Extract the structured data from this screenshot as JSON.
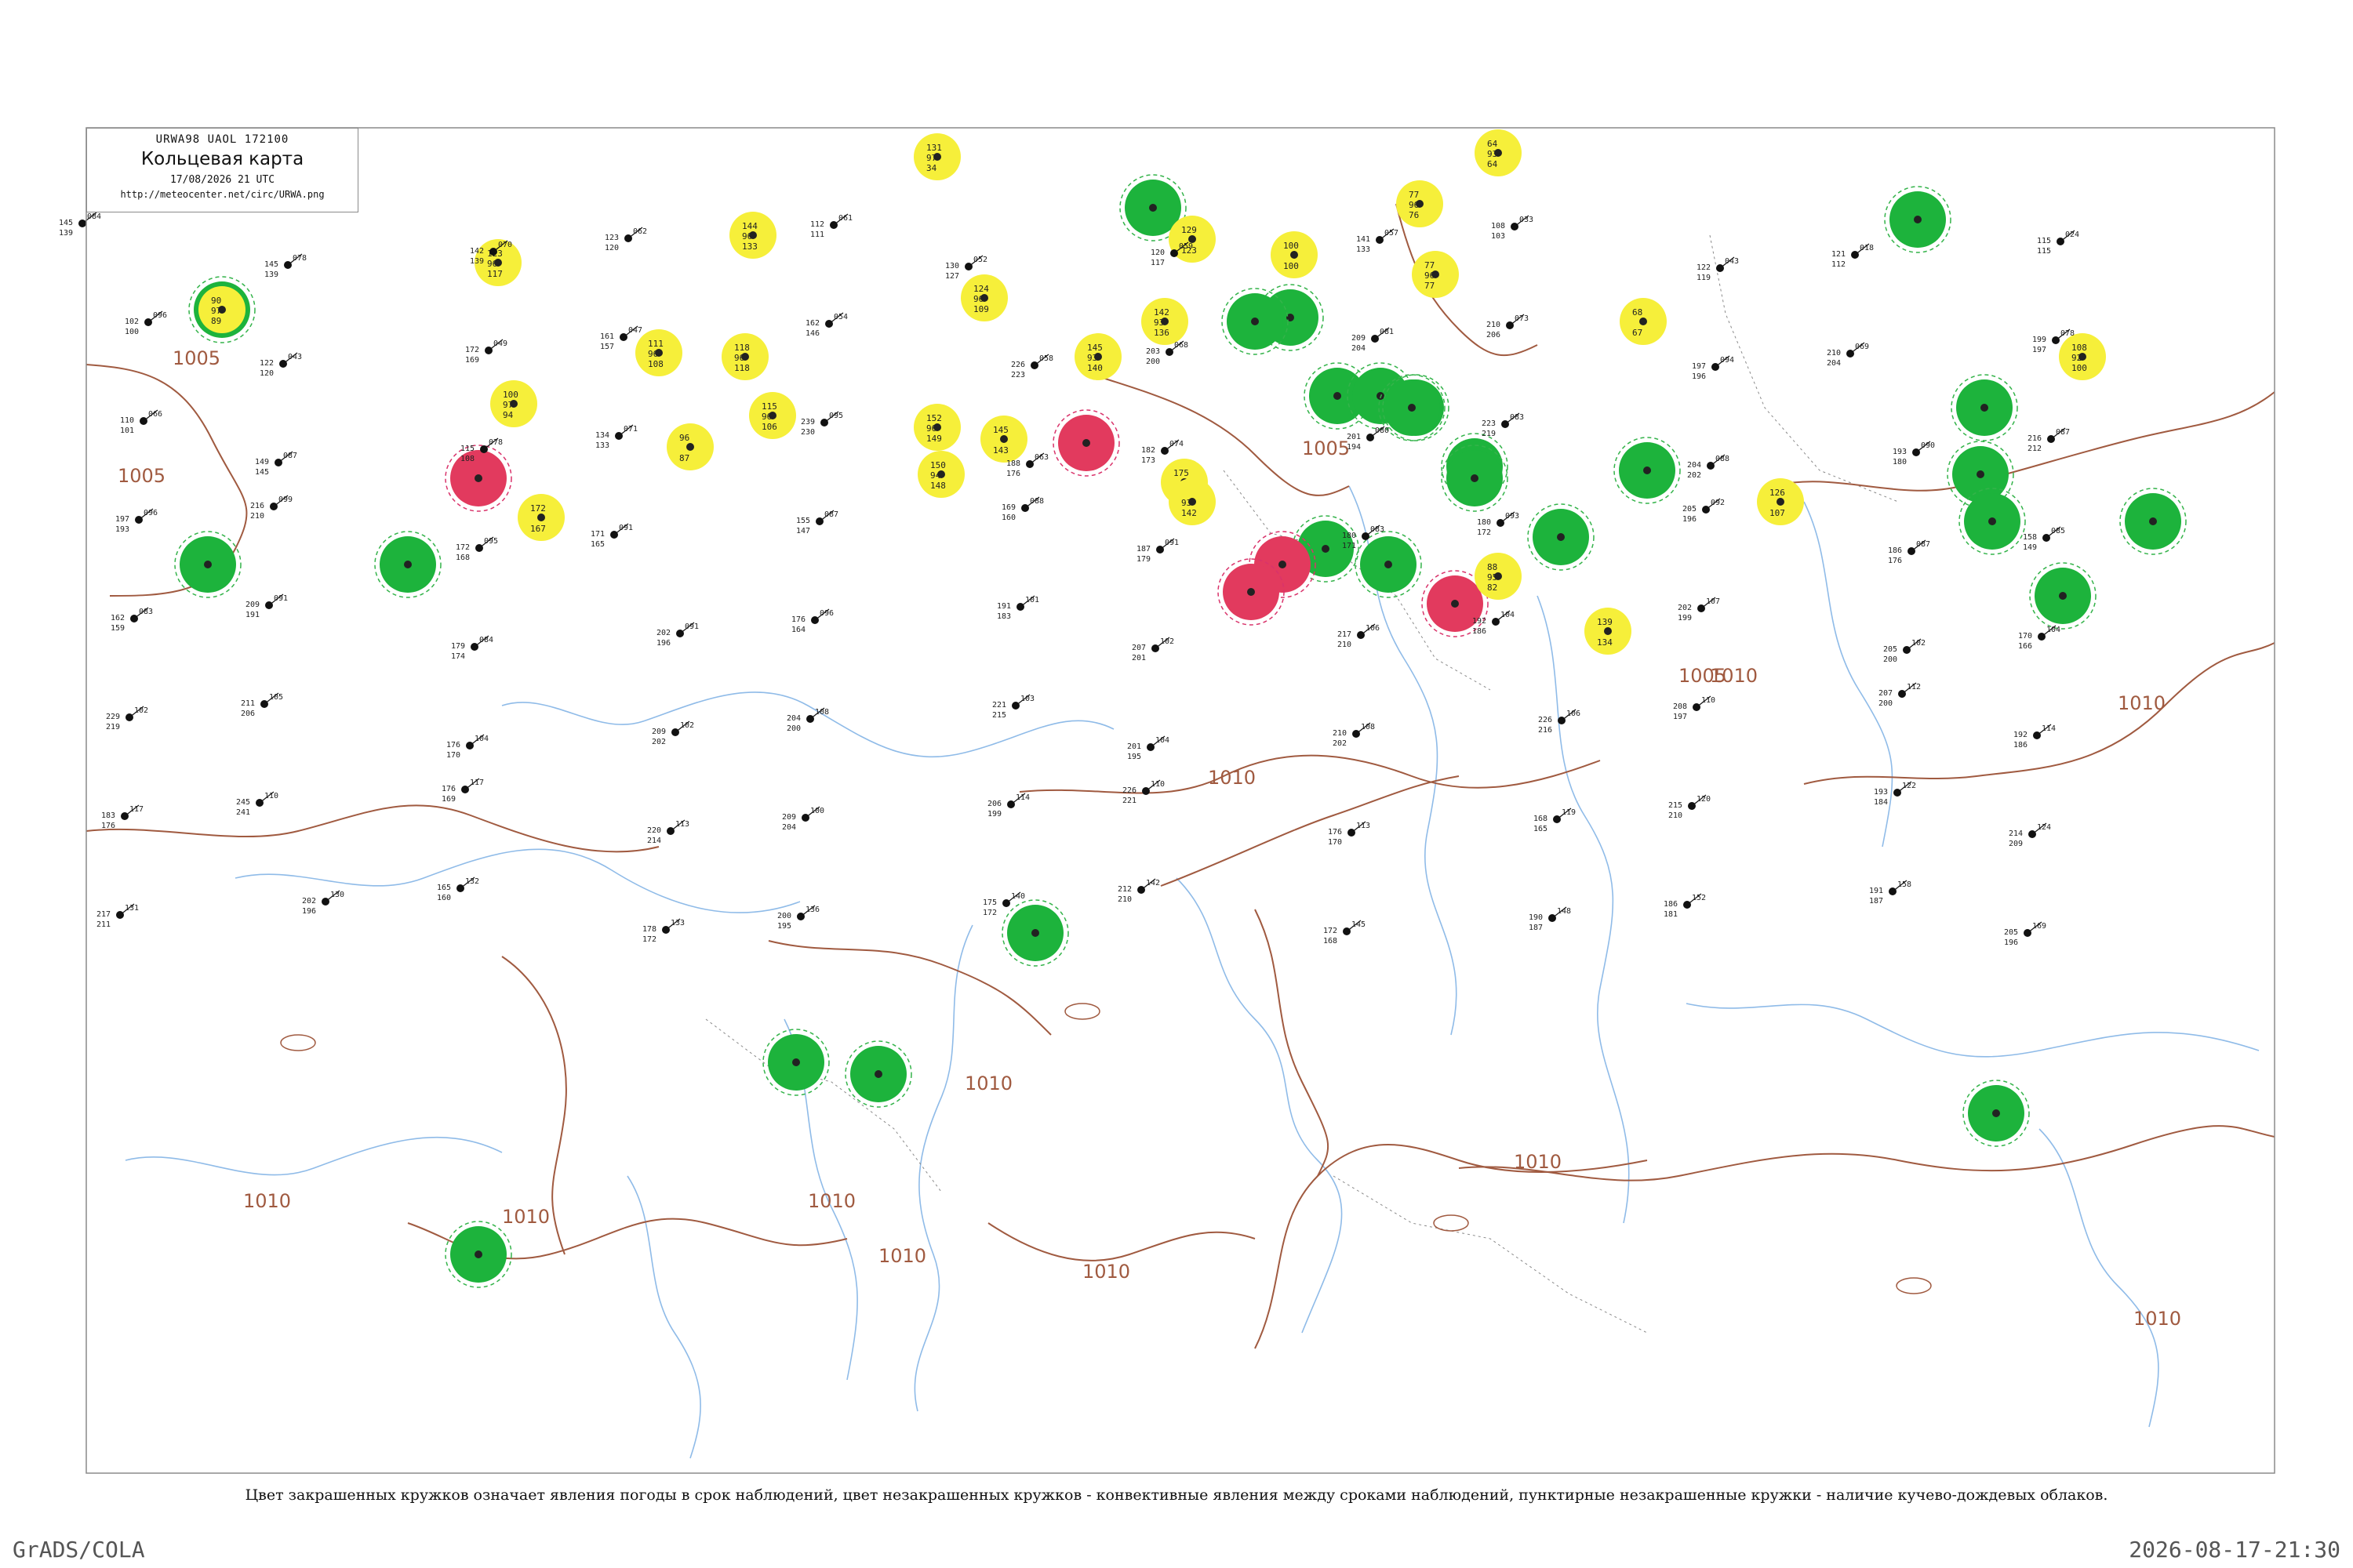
{
  "map": {
    "product_code": "URWA98  UAOL  172100",
    "title": "Кольцевая карта",
    "valid_time": "17/08/2026 21 UTC",
    "source_url": "http://meteocenter.net/circ/URWA.png",
    "caption": "Цвет закрашенных кружков означает явления погоды в срок наблюдений, цвет незакрашенных кружков - конвективные явления между сроками наблюдений, пунктирные незакрашенные кружки - наличие кучево-дождевых облаков.",
    "isobar_labels": [
      "1005",
      "1005",
      "1005",
      "1010",
      "1010",
      "1010",
      "1010",
      "1010",
      "1010",
      "1010",
      "1010",
      "1010",
      "1010",
      "1010",
      "1005"
    ],
    "colors": {
      "filled_green": "#1db33c",
      "filled_yellow": "#f6ef3a",
      "filled_red": "#e23a5e",
      "ring_green": "#34b34a",
      "ring_red": "#d9336b",
      "isobar": "#a05a40",
      "river": "#8fbbe8",
      "border": "#8a8a8a"
    },
    "highlighted_stations": [
      {
        "color": "green",
        "lines": [
          "",
          "",
          ""
        ]
      },
      {
        "color": "green",
        "lines": [
          "",
          "",
          ""
        ]
      },
      {
        "color": "green",
        "lines": [
          "",
          "",
          ""
        ]
      },
      {
        "color": "green",
        "lines": [
          "",
          "",
          ""
        ]
      },
      {
        "color": "green",
        "lines": [
          "",
          "",
          ""
        ]
      },
      {
        "color": "green",
        "lines": [
          "",
          "",
          ""
        ]
      },
      {
        "color": "green",
        "lines": [
          "",
          "",
          ""
        ]
      },
      {
        "color": "green",
        "lines": [
          "",
          "",
          ""
        ]
      },
      {
        "color": "green",
        "lines": [
          "",
          "",
          ""
        ]
      },
      {
        "color": "green",
        "lines": [
          "",
          "",
          ""
        ]
      },
      {
        "color": "green",
        "lines": [
          "",
          "",
          ""
        ]
      },
      {
        "color": "green",
        "lines": [
          "",
          "",
          ""
        ]
      },
      {
        "color": "green",
        "lines": [
          "",
          "",
          ""
        ]
      },
      {
        "color": "green",
        "lines": [
          "",
          "",
          ""
        ]
      },
      {
        "color": "green",
        "lines": [
          "",
          "",
          ""
        ]
      },
      {
        "color": "green",
        "lines": [
          "",
          "",
          ""
        ]
      },
      {
        "color": "green",
        "lines": [
          "",
          "",
          ""
        ]
      },
      {
        "color": "green",
        "lines": [
          "",
          "",
          ""
        ]
      },
      {
        "color": "green",
        "lines": [
          "",
          "",
          ""
        ]
      },
      {
        "color": "green",
        "lines": [
          "",
          "",
          ""
        ]
      },
      {
        "color": "green",
        "lines": [
          "",
          "",
          ""
        ]
      },
      {
        "color": "green",
        "lines": [
          "",
          "",
          ""
        ]
      },
      {
        "color": "green",
        "lines": [
          "",
          "",
          ""
        ]
      },
      {
        "color": "green",
        "lines": [
          "",
          "",
          ""
        ]
      },
      {
        "color": "green",
        "lines": [
          "",
          "",
          ""
        ]
      },
      {
        "color": "green",
        "lines": [
          "",
          "",
          ""
        ]
      },
      {
        "color": "green",
        "lines": [
          "",
          "",
          ""
        ]
      },
      {
        "color": "red",
        "lines": [
          "",
          "",
          ""
        ]
      },
      {
        "color": "red",
        "lines": [
          "",
          "",
          ""
        ]
      },
      {
        "color": "red",
        "lines": [
          "",
          "",
          ""
        ]
      },
      {
        "color": "red",
        "lines": [
          "",
          "",
          ""
        ]
      },
      {
        "color": "red",
        "lines": [
          "",
          "",
          ""
        ]
      },
      {
        "color": "yellow",
        "lines": [
          "64",
          "93",
          "64"
        ]
      },
      {
        "color": "yellow",
        "lines": [
          "131",
          "97",
          "34"
        ]
      },
      {
        "color": "yellow",
        "lines": [
          "144",
          "96",
          "133"
        ]
      },
      {
        "color": "yellow",
        "lines": [
          "123",
          "96",
          "117"
        ]
      },
      {
        "color": "yellow",
        "lines": [
          "100",
          "97",
          "94"
        ]
      },
      {
        "color": "yellow",
        "lines": [
          "111",
          "96",
          "108"
        ]
      },
      {
        "color": "yellow",
        "lines": [
          "118",
          "96",
          "118"
        ]
      },
      {
        "color": "yellow",
        "lines": [
          "115",
          "96",
          "106"
        ]
      },
      {
        "color": "yellow",
        "lines": [
          "96",
          "",
          "87"
        ]
      },
      {
        "color": "yellow",
        "lines": [
          "172",
          "",
          "167"
        ]
      },
      {
        "color": "yellow",
        "lines": [
          "124",
          "96",
          "109"
        ]
      },
      {
        "color": "yellow",
        "lines": [
          "152",
          "96",
          "149"
        ]
      },
      {
        "color": "yellow",
        "lines": [
          "150",
          "94",
          "148"
        ]
      },
      {
        "color": "yellow",
        "lines": [
          "145",
          "",
          "143"
        ]
      },
      {
        "color": "yellow",
        "lines": [
          "145",
          "93",
          "140"
        ]
      },
      {
        "color": "yellow",
        "lines": [
          "142",
          "93",
          "136"
        ]
      },
      {
        "color": "yellow",
        "lines": [
          "129",
          "",
          "123"
        ]
      },
      {
        "color": "yellow",
        "lines": [
          "175",
          "",
          "171"
        ]
      },
      {
        "color": "yellow",
        "lines": [
          "",
          "93",
          "142"
        ]
      },
      {
        "color": "yellow",
        "lines": [
          "100",
          "",
          "100"
        ]
      },
      {
        "color": "yellow",
        "lines": [
          "77",
          "96",
          "76"
        ]
      },
      {
        "color": "yellow",
        "lines": [
          "77",
          "96",
          "77"
        ]
      },
      {
        "color": "yellow",
        "lines": [
          "68",
          "",
          "67"
        ]
      },
      {
        "color": "yellow",
        "lines": [
          "88",
          "95",
          "82"
        ]
      },
      {
        "color": "yellow",
        "lines": [
          "139",
          "",
          "134"
        ]
      },
      {
        "color": "yellow",
        "lines": [
          "126",
          "",
          "107"
        ]
      },
      {
        "color": "yellow",
        "lines": [
          "108",
          "92",
          "100"
        ]
      },
      {
        "color": "yellow",
        "lines": [
          "90",
          "97",
          "89"
        ]
      }
    ],
    "plain_stations": [
      [
        "084",
        "145",
        "139"
      ],
      [
        "078",
        "145",
        "139"
      ],
      [
        "070",
        "142",
        "139"
      ],
      [
        "062",
        "123",
        "120"
      ],
      [
        "061",
        "112",
        "111"
      ],
      [
        "052",
        "130",
        "127"
      ],
      [
        "059",
        "120",
        "117"
      ],
      [
        "057",
        "141",
        "133"
      ],
      [
        "033",
        "108",
        "103"
      ],
      [
        "043",
        "122",
        "119"
      ],
      [
        "018",
        "121",
        "112"
      ],
      [
        "024",
        "115",
        "115"
      ],
      [
        "096",
        "102",
        "100"
      ],
      [
        "043",
        "122",
        "120"
      ],
      [
        "049",
        "172",
        "169"
      ],
      [
        "047",
        "161",
        "157"
      ],
      [
        "054",
        "162",
        "146"
      ],
      [
        "058",
        "226",
        "223"
      ],
      [
        "068",
        "203",
        "200"
      ],
      [
        "081",
        "209",
        "204"
      ],
      [
        "073",
        "210",
        "206"
      ],
      [
        "094",
        "197",
        "196"
      ],
      [
        "069",
        "210",
        "204"
      ],
      [
        "078",
        "199",
        "197"
      ],
      [
        "066",
        "110",
        "101"
      ],
      [
        "087",
        "149",
        "145"
      ],
      [
        "078",
        "115",
        "108"
      ],
      [
        "071",
        "134",
        "133"
      ],
      [
        "095",
        "239",
        "230"
      ],
      [
        "063",
        "188",
        "176"
      ],
      [
        "074",
        "182",
        "173"
      ],
      [
        "080",
        "201",
        "194"
      ],
      [
        "083",
        "223",
        "219"
      ],
      [
        "088",
        "204",
        "202"
      ],
      [
        "090",
        "193",
        "180"
      ],
      [
        "087",
        "216",
        "212"
      ],
      [
        "096",
        "197",
        "193"
      ],
      [
        "099",
        "216",
        "210"
      ],
      [
        "095",
        "172",
        "168"
      ],
      [
        "091",
        "171",
        "165"
      ],
      [
        "087",
        "155",
        "147"
      ],
      [
        "088",
        "169",
        "160"
      ],
      [
        "091",
        "187",
        "179"
      ],
      [
        "083",
        "180",
        "171"
      ],
      [
        "093",
        "180",
        "172"
      ],
      [
        "092",
        "205",
        "196"
      ],
      [
        "087",
        "186",
        "176"
      ],
      [
        "085",
        "158",
        "149"
      ],
      [
        "083",
        "162",
        "159"
      ],
      [
        "091",
        "209",
        "191"
      ],
      [
        "084",
        "179",
        "174"
      ],
      [
        "091",
        "202",
        "196"
      ],
      [
        "096",
        "176",
        "164"
      ],
      [
        "101",
        "191",
        "183"
      ],
      [
        "102",
        "207",
        "201"
      ],
      [
        "106",
        "217",
        "210"
      ],
      [
        "104",
        "192",
        "186"
      ],
      [
        "107",
        "202",
        "199"
      ],
      [
        "102",
        "205",
        "200"
      ],
      [
        "104",
        "170",
        "166"
      ],
      [
        "102",
        "229",
        "219"
      ],
      [
        "105",
        "211",
        "206"
      ],
      [
        "104",
        "176",
        "170"
      ],
      [
        "102",
        "209",
        "202"
      ],
      [
        "108",
        "204",
        "200"
      ],
      [
        "103",
        "221",
        "215"
      ],
      [
        "104",
        "201",
        "195"
      ],
      [
        "108",
        "210",
        "202"
      ],
      [
        "106",
        "226",
        "216"
      ],
      [
        "110",
        "208",
        "197"
      ],
      [
        "112",
        "207",
        "200"
      ],
      [
        "114",
        "192",
        "186"
      ],
      [
        "117",
        "183",
        "176"
      ],
      [
        "110",
        "245",
        "241"
      ],
      [
        "117",
        "176",
        "169"
      ],
      [
        "113",
        "220",
        "214"
      ],
      [
        "100",
        "209",
        "204"
      ],
      [
        "114",
        "206",
        "199"
      ],
      [
        "110",
        "226",
        "221"
      ],
      [
        "113",
        "176",
        "170"
      ],
      [
        "119",
        "168",
        "165"
      ],
      [
        "120",
        "215",
        "210"
      ],
      [
        "122",
        "193",
        "184"
      ],
      [
        "124",
        "214",
        "209"
      ],
      [
        "131",
        "217",
        "211"
      ],
      [
        "130",
        "202",
        "196"
      ],
      [
        "132",
        "165",
        "160"
      ],
      [
        "133",
        "178",
        "172"
      ],
      [
        "136",
        "200",
        "195"
      ],
      [
        "140",
        "175",
        "172"
      ],
      [
        "142",
        "212",
        "210"
      ],
      [
        "145",
        "172",
        "168"
      ],
      [
        "148",
        "190",
        "187"
      ],
      [
        "152",
        "186",
        "181"
      ],
      [
        "158",
        "191",
        "187"
      ],
      [
        "169",
        "205",
        "196"
      ]
    ]
  }
}
